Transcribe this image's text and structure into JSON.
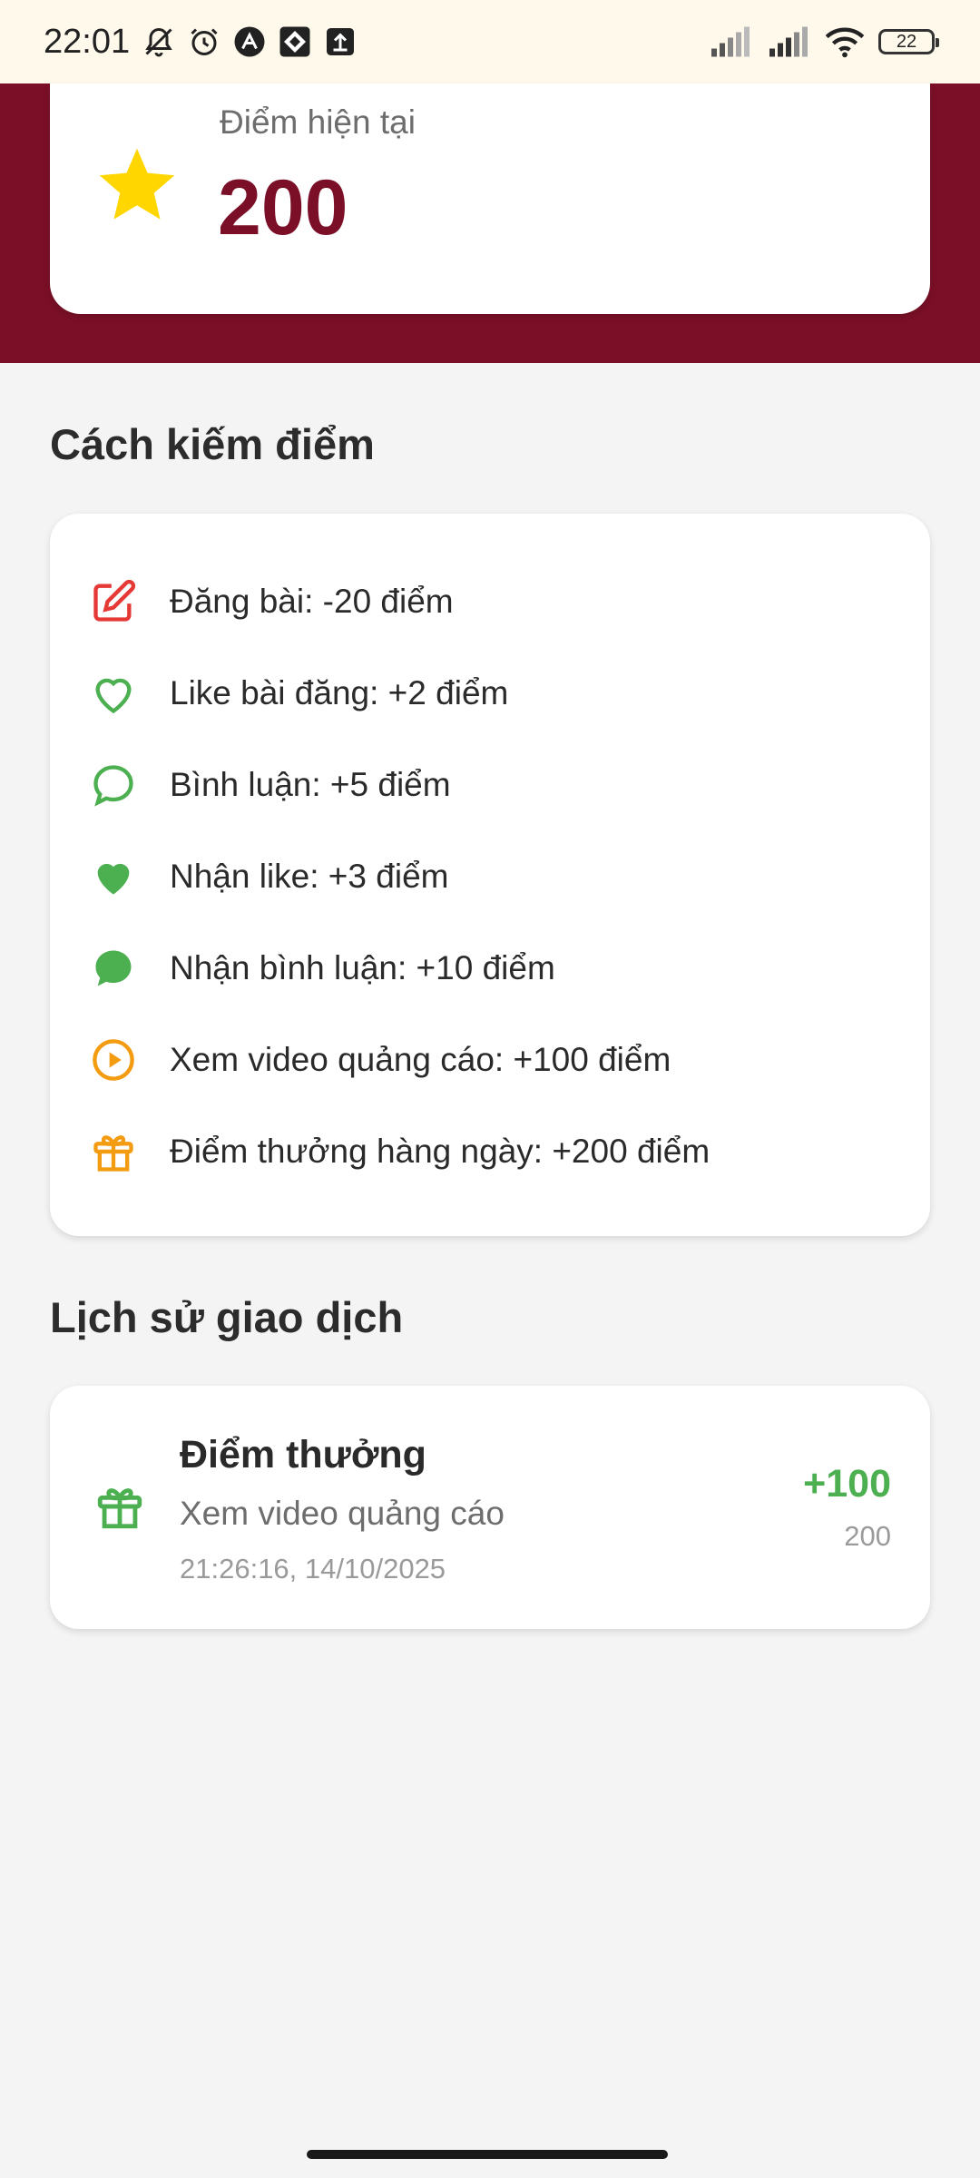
{
  "status_bar": {
    "time": "22:01",
    "battery": "22",
    "icons": [
      "bell-off-icon",
      "alarm-icon",
      "app-a-icon",
      "app-diamond-icon",
      "upload-icon",
      "signal-icon",
      "signal-icon",
      "wifi-icon",
      "battery-icon"
    ]
  },
  "points": {
    "label": "Điểm hiện tại",
    "value": "200",
    "icon": "star-icon",
    "star_color": "#FFD600",
    "value_color": "#7A0F27"
  },
  "earn_section": {
    "title": "Cách kiếm điểm",
    "items": [
      {
        "icon": "edit-icon",
        "text": "Đăng bài: -20 điểm",
        "color": "#E53935"
      },
      {
        "icon": "heart-outline-icon",
        "text": "Like bài đăng: +2 điểm",
        "color": "#4CAF50"
      },
      {
        "icon": "comment-outline-icon",
        "text": "Bình luận: +5 điểm",
        "color": "#4CAF50"
      },
      {
        "icon": "heart-filled-icon",
        "text": "Nhận like: +3 điểm",
        "color": "#4CAF50"
      },
      {
        "icon": "comment-filled-icon",
        "text": "Nhận bình luận: +10 điểm",
        "color": "#4CAF50"
      },
      {
        "icon": "play-circle-icon",
        "text": "Xem video quảng cáo: +100 điểm",
        "color": "#F39C12"
      },
      {
        "icon": "gift-icon",
        "text": "Điểm thưởng hàng ngày: +200 điểm",
        "color": "#F39C12"
      }
    ]
  },
  "history_section": {
    "title": "Lịch sử giao dịch",
    "transactions": [
      {
        "icon": "gift-icon",
        "title": "Điểm thưởng",
        "description": "Xem video quảng cáo",
        "timestamp": "21:26:16, 14/10/2025",
        "amount": "+100",
        "balance": "200",
        "amount_color": "#4CAF50"
      }
    ]
  },
  "theme": {
    "header_color": "#7A0F27",
    "background": "#F4F4F4",
    "status_bar_bg": "#FFF9EC"
  }
}
